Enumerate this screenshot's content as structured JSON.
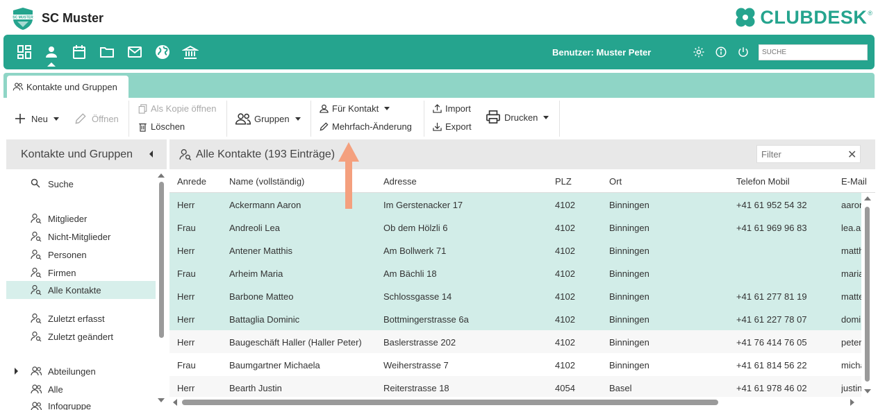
{
  "app": {
    "club_name": "SC Muster",
    "logo_text": "SC MUSTER",
    "brand": "CLUBDESK",
    "brand_mark": "®"
  },
  "colors": {
    "primary": "#25a48e",
    "tab_strip": "#8fd5c6",
    "selected_row": "#d2ede8",
    "annotation_arrow": "#f4a07e"
  },
  "navbar": {
    "icons": [
      "dashboard-icon",
      "contacts-icon",
      "calendar-icon",
      "folder-icon",
      "mail-icon",
      "web-icon",
      "bank-icon"
    ],
    "active": "contacts-icon",
    "user_label": "Benutzer: Muster Peter",
    "search_placeholder": "SUCHE"
  },
  "tab": {
    "label": "Kontakte und Gruppen"
  },
  "toolbar": {
    "new_label": "Neu",
    "open_label": "Öffnen",
    "open_copy_label": "Als Kopie öffnen",
    "delete_label": "Löschen",
    "groups_label": "Gruppen",
    "for_contact_label": "Für Kontakt",
    "multi_change_label": "Mehrfach-Änderung",
    "import_label": "Import",
    "export_label": "Export",
    "print_label": "Drucken"
  },
  "sidebar": {
    "title": "Kontakte und Gruppen",
    "items": [
      {
        "label": "Suche"
      },
      {
        "label": "Mitglieder"
      },
      {
        "label": "Nicht-Mitglieder"
      },
      {
        "label": "Personen"
      },
      {
        "label": "Firmen"
      },
      {
        "label": "Alle Kontakte"
      },
      {
        "label": "Zuletzt erfasst"
      },
      {
        "label": "Zuletzt geändert"
      },
      {
        "label": "Abteilungen"
      },
      {
        "label": "Alle"
      },
      {
        "label": "Infogruppe"
      }
    ]
  },
  "grid": {
    "title": "Alle Kontakte (193 Einträge)",
    "filter_placeholder": "Filter",
    "columns": [
      "Anrede",
      "Name (vollständig)",
      "Adresse",
      "PLZ",
      "Ort",
      "Telefon Mobil",
      "E-Mail"
    ],
    "rows": [
      {
        "anrede": "Herr",
        "name": "Ackermann Aaron",
        "adresse": "Im Gerstenacker 17",
        "plz": "4102",
        "ort": "Binningen",
        "mobil": "+41 61 952 54 32",
        "email": "aaron"
      },
      {
        "anrede": "Frau",
        "name": "Andreoli Lea",
        "adresse": "Ob dem Hölzli 6",
        "plz": "4102",
        "ort": "Binningen",
        "mobil": "+41 61 969 96 83",
        "email": "lea.an"
      },
      {
        "anrede": "Herr",
        "name": "Antener Matthis",
        "adresse": "Am Bollwerk 71",
        "plz": "4102",
        "ort": "Binningen",
        "mobil": "",
        "email": "matth"
      },
      {
        "anrede": "Frau",
        "name": "Arheim Maria",
        "adresse": "Am Bächli 18",
        "plz": "4102",
        "ort": "Binningen",
        "mobil": "",
        "email": "maria"
      },
      {
        "anrede": "Herr",
        "name": "Barbone Matteo",
        "adresse": "Schlossgasse 14",
        "plz": "4102",
        "ort": "Binningen",
        "mobil": "+41 61 277 81 19",
        "email": "matte"
      },
      {
        "anrede": "Herr",
        "name": "Battaglia Dominic",
        "adresse": "Bottmingerstrasse 6a",
        "plz": "4102",
        "ort": "Binningen",
        "mobil": "+41 61 227 78 07",
        "email": "domi"
      },
      {
        "anrede": "Herr",
        "name": "Baugeschäft Haller (Haller Peter)",
        "adresse": "Baslerstrasse 202",
        "plz": "4102",
        "ort": "Binningen",
        "mobil": "+41 76 414 76 05",
        "email": "peter"
      },
      {
        "anrede": "Frau",
        "name": "Baumgartner Michaela",
        "adresse": "Weiherstrasse 7",
        "plz": "4102",
        "ort": "Binningen",
        "mobil": "+41 61 814 56 22",
        "email": "micha"
      },
      {
        "anrede": "Herr",
        "name": "Bearth Justin",
        "adresse": "Reiterstrasse 18",
        "plz": "4054",
        "ort": "Basel",
        "mobil": "+41 61 978 46 02",
        "email": "justin"
      }
    ]
  }
}
